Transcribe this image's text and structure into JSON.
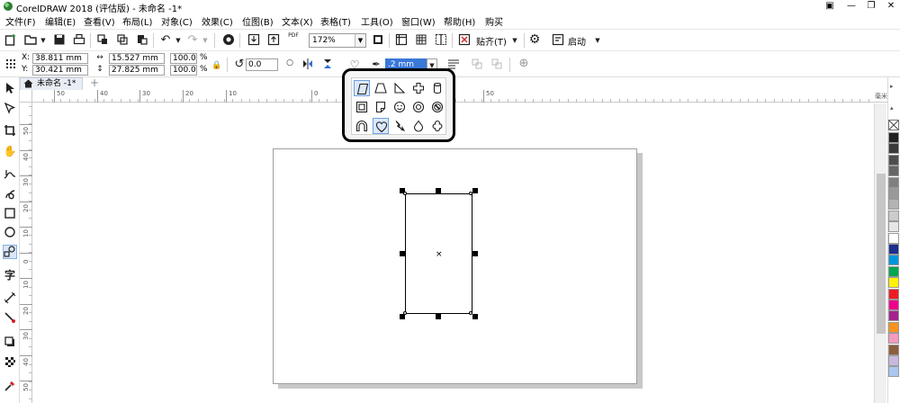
{
  "window": {
    "title": "CorelDRAW 2018 (评估版) - 未命名 -1*",
    "controls": {
      "minimize": "—",
      "restore": "❐",
      "close": "✕",
      "account": "▣"
    }
  },
  "menu": [
    "文件(F)",
    "编辑(E)",
    "查看(V)",
    "布局(L)",
    "对象(C)",
    "效果(C)",
    "位图(B)",
    "文本(X)",
    "表格(T)",
    "工具(O)",
    "窗口(W)",
    "帮助(H)",
    "购买"
  ],
  "toolbar1": {
    "zoom": "172%",
    "snap_label": "贴齐(T)",
    "launch_label": "启动",
    "pdf_label": "PDF"
  },
  "toolbar2": {
    "x_label": "X:",
    "x_value": "38.811 mm",
    "y_label": "Y:",
    "y_value": "30.421 mm",
    "width_value": "15.527 mm",
    "height_value": "27.825 mm",
    "scale_w": "100.0",
    "scale_h": "100.0",
    "percent": "%",
    "rotation": "0.0",
    "outline_width": ".2 mm"
  },
  "tab": {
    "label": "未命名 -1*",
    "add": "+"
  },
  "ruler": {
    "unit": "毫米",
    "h_labels": [
      "50",
      "40",
      "30",
      "20",
      "10",
      "0",
      "10",
      "50"
    ],
    "v_labels": [
      "50",
      "40",
      "30",
      "20",
      "10",
      "0",
      "10",
      "20",
      "30",
      "40",
      "50"
    ]
  },
  "flyout": {
    "shapes": [
      [
        "parallelogram-icon",
        "trapezoid-icon",
        "right-triangle-icon",
        "cross-icon",
        "cylinder-icon"
      ],
      [
        "frame-icon",
        "folded-corner-icon",
        "smiley-icon",
        "donut-icon",
        "no-symbol-icon"
      ],
      [
        "arch-icon",
        "heart-icon",
        "lightning-icon",
        "teardrop-icon",
        "octagon-icon"
      ]
    ]
  },
  "palette": [
    "#222222",
    "#3a3a3a",
    "#4d4d4d",
    "#666666",
    "#808080",
    "#999999",
    "#b3b3b3",
    "#cccccc",
    "#e6e6e6",
    "#ffffff",
    "#1c2f8c",
    "#0095da",
    "#00a650",
    "#fff200",
    "#ed1c24",
    "#ec008c",
    "#a3238e",
    "#f7941d",
    "#f49ac1",
    "#8b5e3c",
    "#c7b8e0",
    "#a8c8f0"
  ],
  "colors": {
    "accent": "#3a78d8",
    "selected_tool": "#d8e6f8"
  }
}
